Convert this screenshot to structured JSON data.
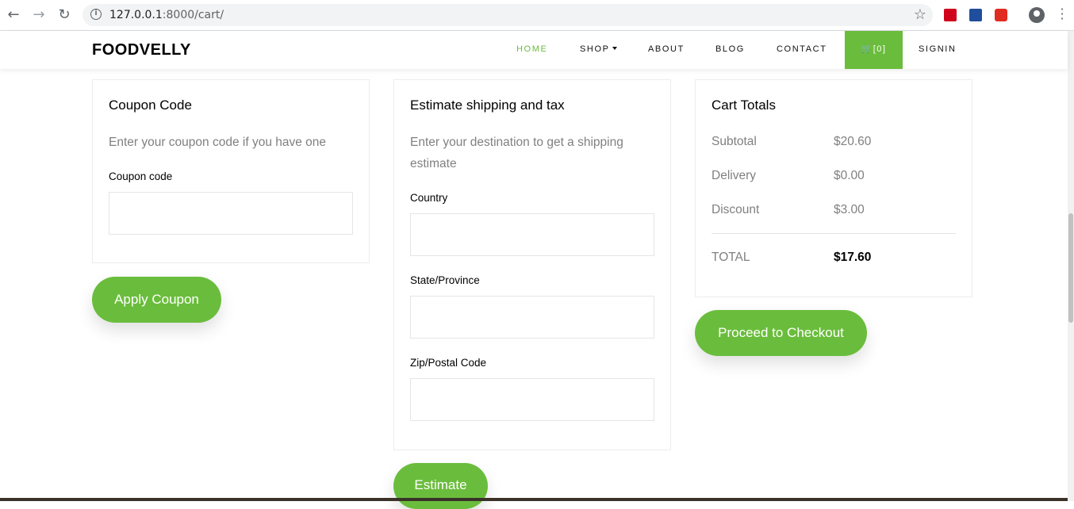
{
  "browser": {
    "url_host": "127.0.0.1",
    "url_rest": ":8000/cart/",
    "back_icon": "arrow-left-icon",
    "forward_icon": "arrow-right-icon",
    "reload_icon": "reload-icon"
  },
  "nav": {
    "brand": "FOODVELLY",
    "items": {
      "home": "HOME",
      "shop": "SHOP",
      "about": "ABOUT",
      "blog": "BLOG",
      "contact": "CONTACT",
      "signin": "SIGNIN"
    },
    "cart_label": "[0]",
    "accent": "#6abd3c"
  },
  "coupon": {
    "title": "Coupon Code",
    "desc": "Enter your coupon code if you have one",
    "field_label": "Coupon code",
    "field_value": "",
    "button": "Apply Coupon"
  },
  "shipping": {
    "title": "Estimate shipping and tax",
    "desc": "Enter your destination to get a shipping estimate",
    "country_label": "Country",
    "state_label": "State/Province",
    "zip_label": "Zip/Postal Code",
    "button": "Estimate"
  },
  "totals": {
    "title": "Cart Totals",
    "subtotal_label": "Subtotal",
    "subtotal_value": "$20.60",
    "delivery_label": "Delivery",
    "delivery_value": "$0.00",
    "discount_label": "Discount",
    "discount_value": "$3.00",
    "total_label": "TOTAL",
    "total_value": "$17.60",
    "button": "Proceed to Checkout"
  }
}
